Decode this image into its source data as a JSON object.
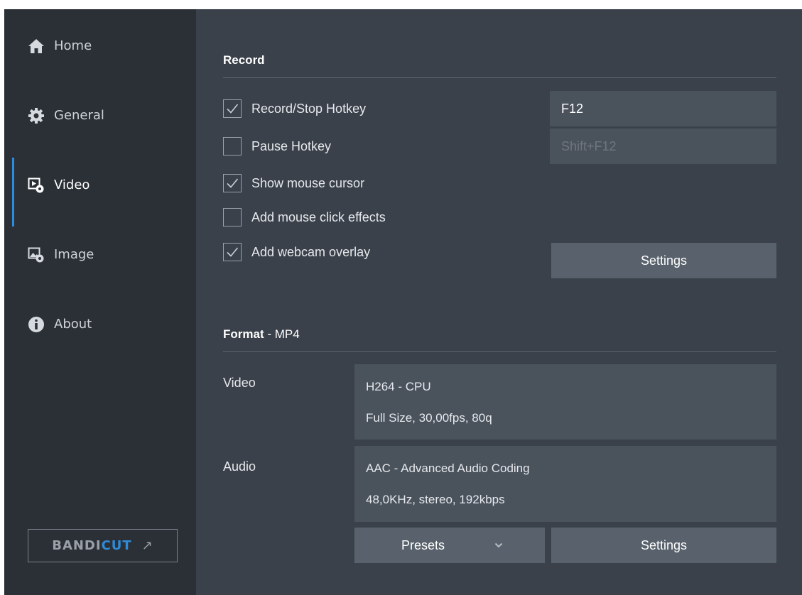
{
  "sidebar": {
    "items": [
      {
        "label": "Home",
        "icon": "home-icon"
      },
      {
        "label": "General",
        "icon": "gear-icon"
      },
      {
        "label": "Video",
        "icon": "video-settings-icon",
        "active": true
      },
      {
        "label": "Image",
        "icon": "image-settings-icon"
      },
      {
        "label": "About",
        "icon": "info-icon"
      }
    ],
    "bandicut": {
      "part1": "BANDI",
      "part2": "CUT",
      "arrow": "↗"
    }
  },
  "record": {
    "title": "Record",
    "options": [
      {
        "label": "Record/Stop Hotkey",
        "checked": true
      },
      {
        "label": "Pause Hotkey",
        "checked": false
      },
      {
        "label": "Show mouse cursor",
        "checked": true
      },
      {
        "label": "Add mouse click effects",
        "checked": false
      },
      {
        "label": "Add webcam overlay",
        "checked": true
      }
    ],
    "hotkey_record": "F12",
    "hotkey_pause": "Shift+F12",
    "webcam_settings_label": "Settings"
  },
  "format": {
    "title": "Format",
    "subtitle": " - MP4",
    "video_label": "Video",
    "video_codec": "H264 - CPU",
    "video_details": "Full Size, 30,00fps, 80q",
    "audio_label": "Audio",
    "audio_codec": "AAC - Advanced Audio Coding",
    "audio_details": "48,0KHz, stereo, 192kbps",
    "presets_label": "Presets",
    "settings_label": "Settings"
  },
  "colors": {
    "accent": "#2f8bd8",
    "sidebar_bg": "#2b3037",
    "main_bg": "#3a414a",
    "field_bg": "#4a525c",
    "button_bg": "#59626c"
  }
}
